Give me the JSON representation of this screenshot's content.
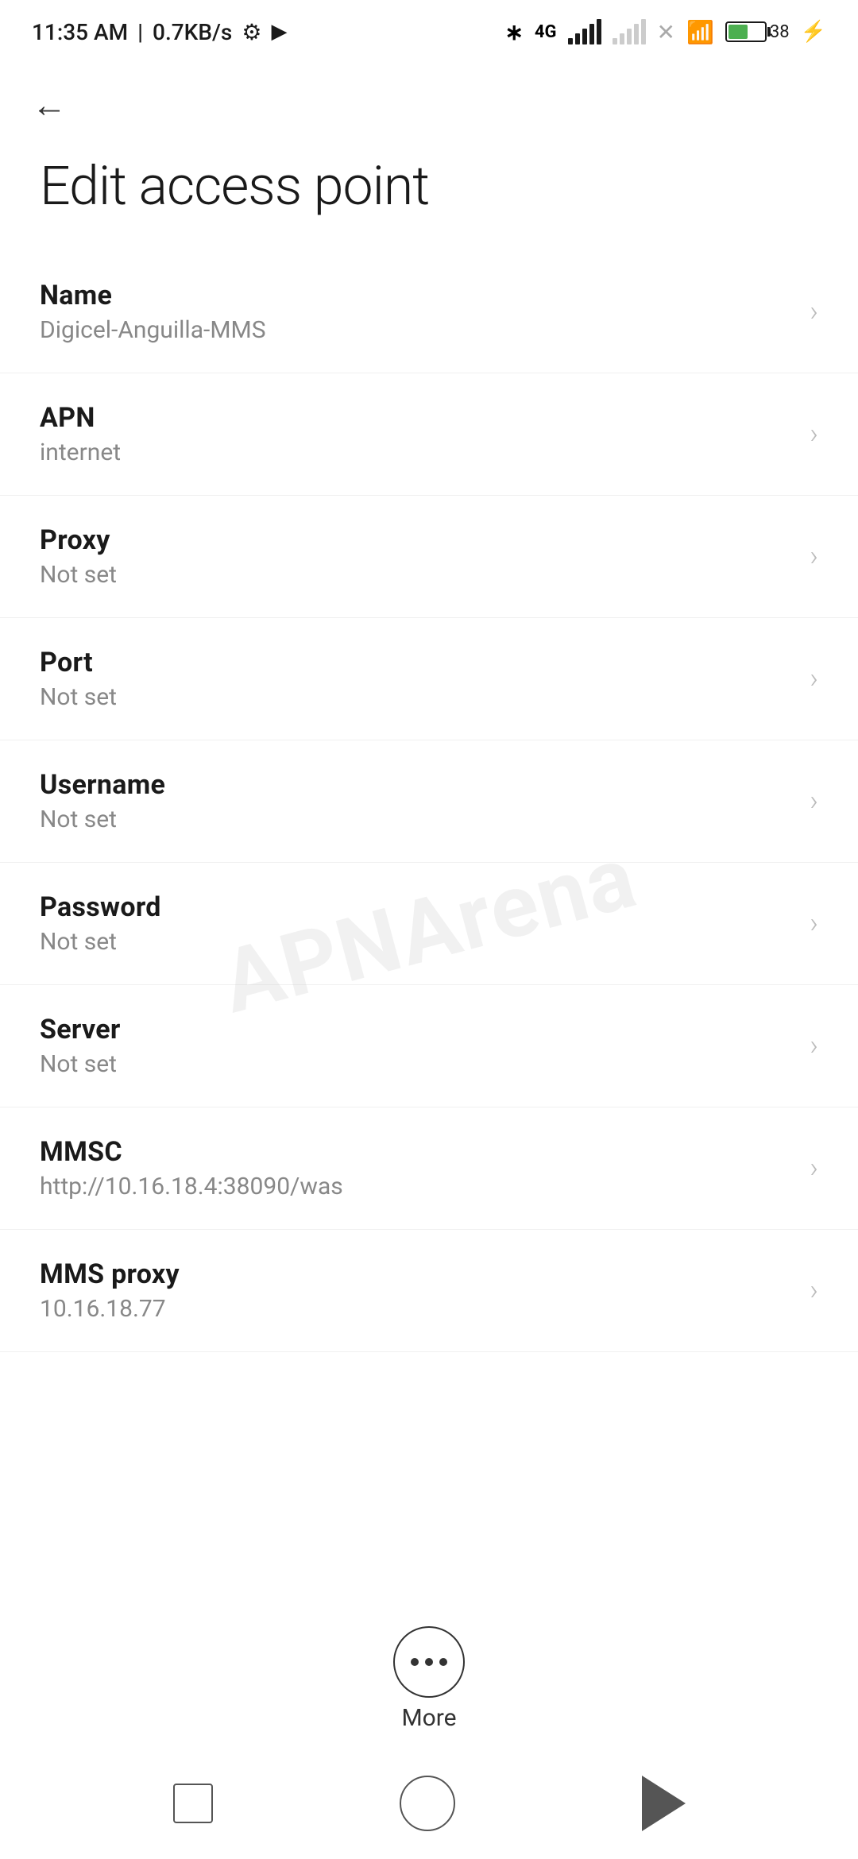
{
  "statusBar": {
    "time": "11:35 AM",
    "speed": "0.7KB/s",
    "battery_percent": "38"
  },
  "header": {
    "back_label": "←",
    "title": "Edit access point"
  },
  "settings": {
    "items": [
      {
        "label": "Name",
        "value": "Digicel-Anguilla-MMS"
      },
      {
        "label": "APN",
        "value": "internet"
      },
      {
        "label": "Proxy",
        "value": "Not set"
      },
      {
        "label": "Port",
        "value": "Not set"
      },
      {
        "label": "Username",
        "value": "Not set"
      },
      {
        "label": "Password",
        "value": "Not set"
      },
      {
        "label": "Server",
        "value": "Not set"
      },
      {
        "label": "MMSC",
        "value": "http://10.16.18.4:38090/was"
      },
      {
        "label": "MMS proxy",
        "value": "10.16.18.77"
      }
    ]
  },
  "more_button": {
    "label": "More"
  },
  "watermark": {
    "text": "APNArena"
  }
}
